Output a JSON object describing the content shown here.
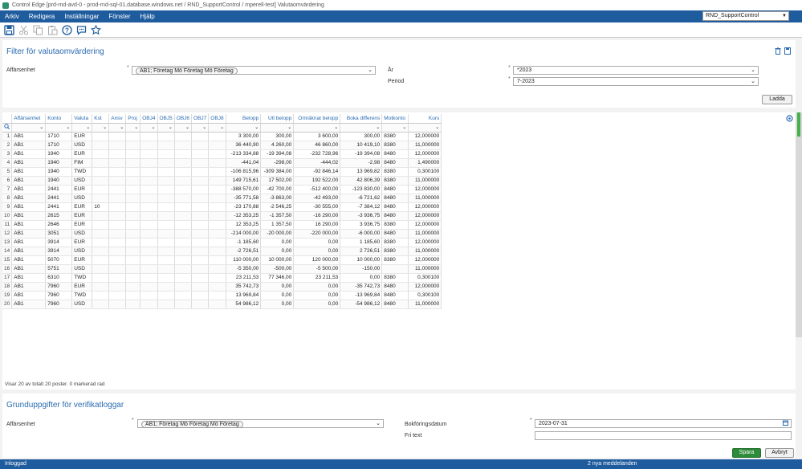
{
  "window": {
    "title": "Control Edge [prd-rnd-avd-0 - prod-rnd-sql-01.database.windows.net / RND_SupportControl / mperell-test] Valutaomvärdering"
  },
  "menu": [
    "Arkiv",
    "Redigera",
    "Inställningar",
    "Fönster",
    "Hjälp"
  ],
  "company_selector": {
    "value": "RND_SupportControl"
  },
  "toolbar_icons": [
    "save-icon",
    "cut-icon",
    "copy-icon",
    "paste-icon",
    "help-icon",
    "chat-icon",
    "star-icon"
  ],
  "filter": {
    "title": "Filter för valutaomvärdering",
    "affarsenhet_label": "Affärsenhet",
    "affarsenhet_value": "AB1; Företag Mö Företag Mö Företag",
    "ar_label": "År",
    "ar_value": "*2023",
    "period_label": "Period",
    "period_value": "7-2023",
    "load_button": "Ladda"
  },
  "grid": {
    "columns": [
      "Affärsenhet",
      "Konto",
      "Valuta",
      "Kst",
      "Ansv",
      "Proj",
      "OBJ4",
      "OBJ5",
      "OBJ6",
      "OBJ7",
      "OBJ8",
      "Belopp",
      "Utl belopp",
      "Omräknat belopp",
      "Boka differens",
      "Motkonto",
      "Kurs"
    ],
    "rows": [
      [
        "1",
        "AB1",
        "1710",
        "EUR",
        "",
        "",
        "",
        "",
        "",
        "",
        "",
        "",
        "3 300,00",
        "300,00",
        "3 600,00",
        "300,00",
        "8380",
        "12,000000"
      ],
      [
        "2",
        "AB1",
        "1710",
        "USD",
        "",
        "",
        "",
        "",
        "",
        "",
        "",
        "",
        "36 440,90",
        "4 260,00",
        "46 860,00",
        "10 419,10",
        "8380",
        "11,000000"
      ],
      [
        "3",
        "AB1",
        "1940",
        "EUR",
        "",
        "",
        "",
        "",
        "",
        "",
        "",
        "",
        "-213 334,88",
        "-19 394,08",
        "-232 728,96",
        "-19 394,08",
        "8480",
        "12,000000"
      ],
      [
        "4",
        "AB1",
        "1940",
        "FIM",
        "",
        "",
        "",
        "",
        "",
        "",
        "",
        "",
        "-441,04",
        "-298,00",
        "-444,02",
        "-2,98",
        "8480",
        "1,490000"
      ],
      [
        "5",
        "AB1",
        "1940",
        "TWD",
        "",
        "",
        "",
        "",
        "",
        "",
        "",
        "",
        "-106 815,96",
        "-309 384,00",
        "-92 846,14",
        "13 969,82",
        "8380",
        "0,300100"
      ],
      [
        "6",
        "AB1",
        "1940",
        "USD",
        "",
        "",
        "",
        "",
        "",
        "",
        "",
        "",
        "149 715,61",
        "17 502,00",
        "192 522,00",
        "42 806,39",
        "8380",
        "11,000000"
      ],
      [
        "7",
        "AB1",
        "2441",
        "EUR",
        "",
        "",
        "",
        "",
        "",
        "",
        "",
        "",
        "-388 570,00",
        "-42 700,00",
        "-512 400,00",
        "-123 830,00",
        "8480",
        "12,000000"
      ],
      [
        "8",
        "AB1",
        "2441",
        "USD",
        "",
        "",
        "",
        "",
        "",
        "",
        "",
        "",
        "-35 771,58",
        "-3 863,00",
        "-42 493,00",
        "-6 721,62",
        "8480",
        "11,000000"
      ],
      [
        "9",
        "AB1",
        "2441",
        "EUR",
        "10",
        "",
        "",
        "",
        "",
        "",
        "",
        "",
        "-23 170,88",
        "-2 546,25",
        "-30 555,00",
        "-7 384,12",
        "8480",
        "12,000000"
      ],
      [
        "10",
        "AB1",
        "2615",
        "EUR",
        "",
        "",
        "",
        "",
        "",
        "",
        "",
        "",
        "-12 353,25",
        "-1 357,50",
        "-16 290,00",
        "-3 936,75",
        "8480",
        "12,000000"
      ],
      [
        "11",
        "AB1",
        "2646",
        "EUR",
        "",
        "",
        "",
        "",
        "",
        "",
        "",
        "",
        "12 353,25",
        "1 357,50",
        "16 290,00",
        "3 936,75",
        "8380",
        "12,000000"
      ],
      [
        "12",
        "AB1",
        "3051",
        "USD",
        "",
        "",
        "",
        "",
        "",
        "",
        "",
        "",
        "-214 000,00",
        "-20 000,00",
        "-220 000,00",
        "-6 000,00",
        "8480",
        "11,000000"
      ],
      [
        "13",
        "AB1",
        "3914",
        "EUR",
        "",
        "",
        "",
        "",
        "",
        "",
        "",
        "",
        "-1 185,60",
        "0,00",
        "0,00",
        "1 185,60",
        "8380",
        "12,000000"
      ],
      [
        "14",
        "AB1",
        "3914",
        "USD",
        "",
        "",
        "",
        "",
        "",
        "",
        "",
        "",
        "-2 726,51",
        "0,00",
        "0,00",
        "2 726,51",
        "8380",
        "11,000000"
      ],
      [
        "15",
        "AB1",
        "5070",
        "EUR",
        "",
        "",
        "",
        "",
        "",
        "",
        "",
        "",
        "110 000,00",
        "10 000,00",
        "120 000,00",
        "10 000,00",
        "8380",
        "12,000000"
      ],
      [
        "16",
        "AB1",
        "5751",
        "USD",
        "",
        "",
        "",
        "",
        "",
        "",
        "",
        "",
        "-5 350,00",
        "-500,00",
        "-5 500,00",
        "-150,00",
        "",
        "11,000000"
      ],
      [
        "17",
        "AB1",
        "6310",
        "TWD",
        "",
        "",
        "",
        "",
        "",
        "",
        "",
        "",
        "23 211,53",
        "77 346,00",
        "23 211,53",
        "0,00",
        "8380",
        "0,300100"
      ],
      [
        "18",
        "AB1",
        "7960",
        "EUR",
        "",
        "",
        "",
        "",
        "",
        "",
        "",
        "",
        "35 742,73",
        "0,00",
        "0,00",
        "-35 742,73",
        "8480",
        "12,000000"
      ],
      [
        "19",
        "AB1",
        "7960",
        "TWD",
        "",
        "",
        "",
        "",
        "",
        "",
        "",
        "",
        "13 969,84",
        "0,00",
        "0,00",
        "-13 969,84",
        "8480",
        "0,300100"
      ],
      [
        "20",
        "AB1",
        "7960",
        "USD",
        "",
        "",
        "",
        "",
        "",
        "",
        "",
        "",
        "54 986,12",
        "0,00",
        "0,00",
        "-54 986,12",
        "8480",
        "11,000000"
      ]
    ],
    "status": "Visar 20 av totalt 20 poster. 0 markerad rad"
  },
  "basis": {
    "title": "Grunduppgifter för verifikatloggar",
    "affarsenhet_label": "Affärsenhet",
    "affarsenhet_value": "AB1; Företag Mö Företag Mö Företag",
    "date_label": "Bokföringsdatum",
    "date_value": "2023-07-31",
    "fritext_label": "Fri text",
    "fritext_value": "",
    "save_button": "Spara",
    "cancel_button": "Avbryt"
  },
  "statusbar": {
    "left": "Inloggad",
    "messages": "2 nya meddelanden"
  }
}
